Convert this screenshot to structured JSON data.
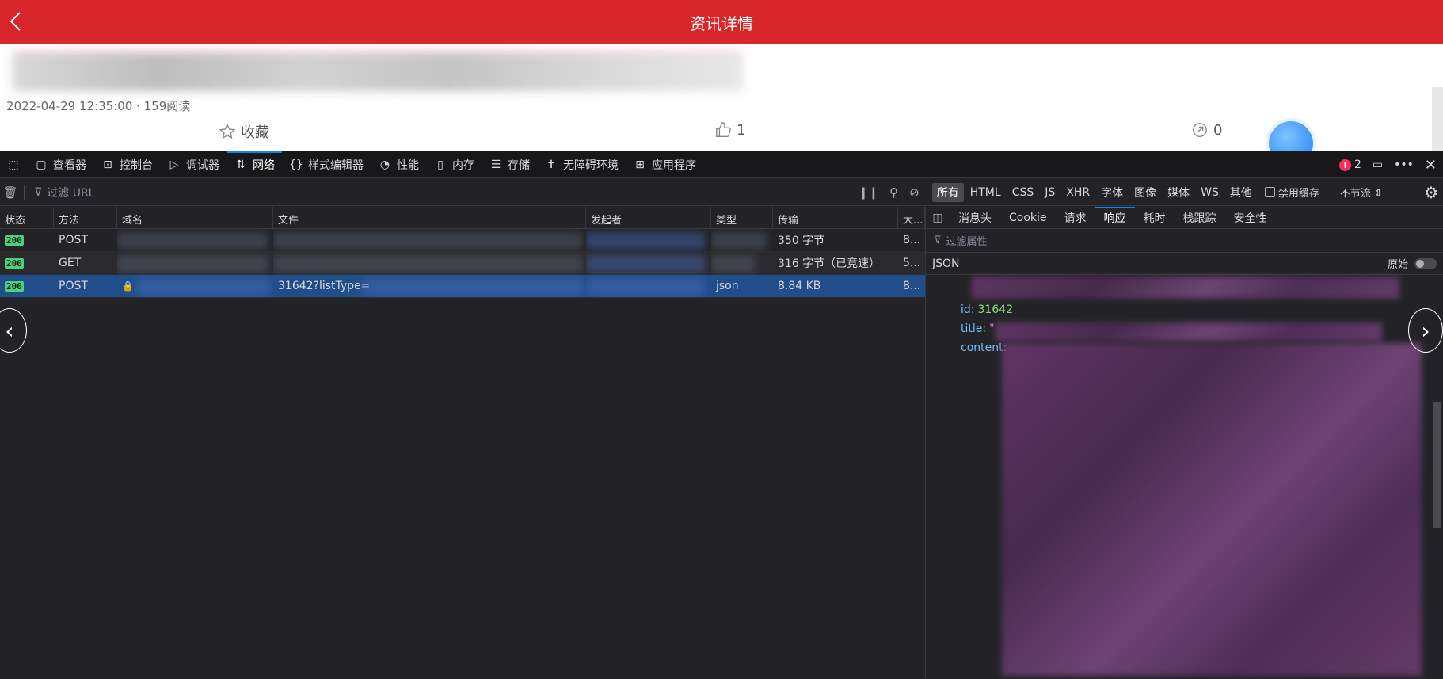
{
  "app": {
    "title": "资讯详情",
    "meta": "2022-04-29 12:35:00 · 159阅读",
    "favorite_label": "收藏",
    "like_count": "1",
    "share_count": "0"
  },
  "devtools": {
    "tabs": [
      {
        "label": "查看器",
        "icon": "inspector-icon"
      },
      {
        "label": "控制台",
        "icon": "console-icon"
      },
      {
        "label": "调试器",
        "icon": "debugger-icon"
      },
      {
        "label": "网络",
        "icon": "network-arrows-icon",
        "active": true
      },
      {
        "label": "样式编辑器",
        "icon": "braces-icon"
      },
      {
        "label": "性能",
        "icon": "gauge-icon"
      },
      {
        "label": "内存",
        "icon": "chip-icon"
      },
      {
        "label": "存储",
        "icon": "storage-icon"
      },
      {
        "label": "无障碍环境",
        "icon": "accessibility-icon"
      },
      {
        "label": "应用程序",
        "icon": "grid-icon"
      }
    ],
    "error_count": "2",
    "filter_placeholder": "过滤 URL",
    "type_filters": [
      "所有",
      "HTML",
      "CSS",
      "JS",
      "XHR",
      "字体",
      "图像",
      "媒体",
      "WS",
      "其他"
    ],
    "disable_cache_label": "禁用缓存",
    "throttle_label": "不节流",
    "columns": [
      "状态",
      "方法",
      "域名",
      "文件",
      "发起者",
      "类型",
      "传输",
      "大..."
    ],
    "requests": [
      {
        "status": "200",
        "method": "POST",
        "file": "",
        "type": "",
        "transfer": "350 字节",
        "size": "8..."
      },
      {
        "status": "200",
        "method": "GET",
        "file": "",
        "type": "",
        "transfer": "316 字节（已竞速）",
        "size": "5..."
      },
      {
        "status": "200",
        "method": "POST",
        "file": "31642?listType=",
        "type": "json",
        "transfer": "8.84 KB",
        "size": "8..."
      }
    ],
    "detail_tabs": [
      "消息头",
      "Cookie",
      "请求",
      "响应",
      "耗时",
      "栈跟踪",
      "安全性"
    ],
    "detail_active": "响应",
    "filter_props_placeholder": "过滤属性",
    "json_label": "JSON",
    "raw_label": "原始",
    "json": {
      "id_key": "id:",
      "id_value": "31642",
      "title_key": "title:",
      "title_value": "\"",
      "content_key": "content:"
    }
  },
  "colors": {
    "header_red": "#d9262a",
    "devtools_bg": "#232327",
    "selected_row": "#204e8a",
    "accent_blue": "#0a84ff",
    "status_green": "#4cd37a"
  }
}
